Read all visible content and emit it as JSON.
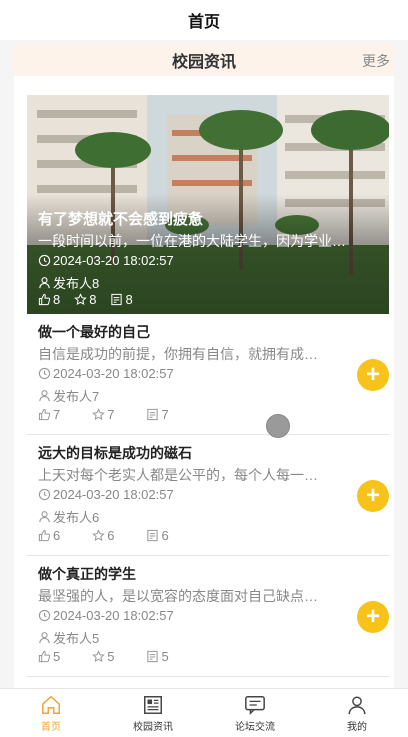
{
  "topbar": {
    "title": "首页"
  },
  "section": {
    "title": "校园资讯",
    "more": "更多"
  },
  "hero": {
    "title": "有了梦想就不会感到疲惫",
    "description": "一段时间以前，一位在港的大陆学生，因为学业…",
    "date": "2024-03-20 18:02:57",
    "publisher": "发布人8",
    "likes": "8",
    "favorites": "8",
    "comments": "8"
  },
  "items": [
    {
      "title": "做一个最好的自己",
      "description": "自信是成功的前提，你拥有自信，就拥有成…",
      "date": "2024-03-20 18:02:57",
      "publisher": "发布人7",
      "likes": "7",
      "favorites": "7",
      "comments": "7",
      "fab": "+"
    },
    {
      "title": "远大的目标是成功的磁石",
      "description": "上天对每个老实人都是公平的，每个人每一…",
      "date": "2024-03-20 18:02:57",
      "publisher": "发布人6",
      "likes": "6",
      "favorites": "6",
      "comments": "6",
      "fab": "+"
    },
    {
      "title": "做个真正的学生",
      "description": "最坚强的人，是以宽容的态度面对自己缺点…",
      "date": "2024-03-20 18:02:57",
      "publisher": "发布人5",
      "likes": "5",
      "favorites": "5",
      "comments": "5",
      "fab": "+"
    }
  ],
  "tabbar": {
    "tabs": [
      {
        "label": "首页",
        "icon": "home-icon",
        "active": true
      },
      {
        "label": "校园资讯",
        "icon": "news-icon",
        "active": false
      },
      {
        "label": "论坛交流",
        "icon": "chat-icon",
        "active": false
      },
      {
        "label": "我的",
        "icon": "user-icon",
        "active": false
      }
    ]
  },
  "colors": {
    "accent": "#f7c31b",
    "active_tab": "#f2a33a",
    "header_bg": "#fdf3ea"
  }
}
